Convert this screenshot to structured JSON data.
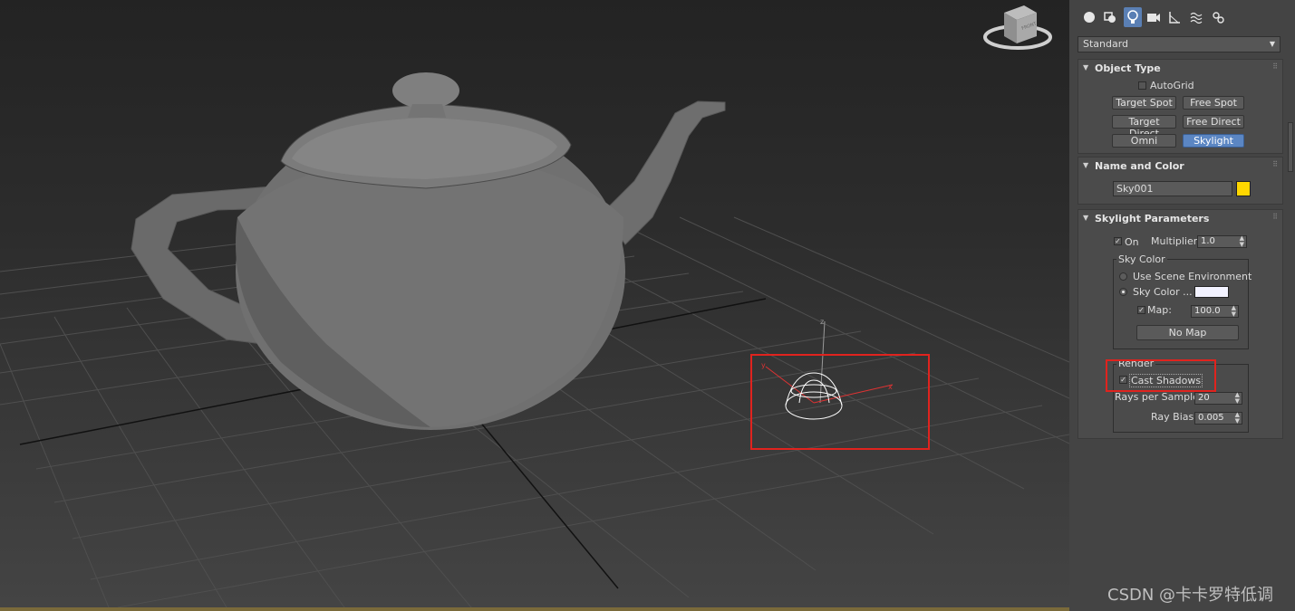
{
  "toolbar": {
    "tabs": [
      "geometry-icon",
      "shapes-icon",
      "lights-icon",
      "cameras-icon",
      "helpers-icon",
      "spacewarps-icon",
      "systems-icon"
    ],
    "active_tab": "lights-icon"
  },
  "type_dropdown": {
    "value": "Standard"
  },
  "object_type": {
    "title": "Object Type",
    "autogrid_label": "AutoGrid",
    "buttons": [
      "Target Spot",
      "Free Spot",
      "Target Direct",
      "Free Direct",
      "Omni",
      "Skylight"
    ],
    "selected": "Skylight"
  },
  "name_color": {
    "title": "Name and Color",
    "name_value": "Sky001",
    "color": "#ffd700"
  },
  "skylight": {
    "title": "Skylight Parameters",
    "on_label": "On",
    "multiplier_label": "Multiplier:",
    "multiplier_value": "1.0",
    "sky_color_group": "Sky Color",
    "use_scene_env_label": "Use Scene Environment",
    "sky_color_label": "Sky Color ...",
    "map_label": "Map:",
    "map_value": "100.0",
    "no_map_label": "No Map",
    "render_group": "Render",
    "cast_shadows_label": "Cast Shadows",
    "rays_label": "Rays per Sample:",
    "rays_value": "20",
    "ray_bias_label": "Ray Bias:",
    "ray_bias_value": "0.005"
  },
  "viewcube": {
    "face_label": "FRONT"
  },
  "axes": {
    "x": "x",
    "y": "y",
    "z": "z"
  },
  "watermark": "CSDN @卡卡罗特低调",
  "colors": {
    "highlight": "#e0231e",
    "selected_button": "#5b86c3"
  }
}
